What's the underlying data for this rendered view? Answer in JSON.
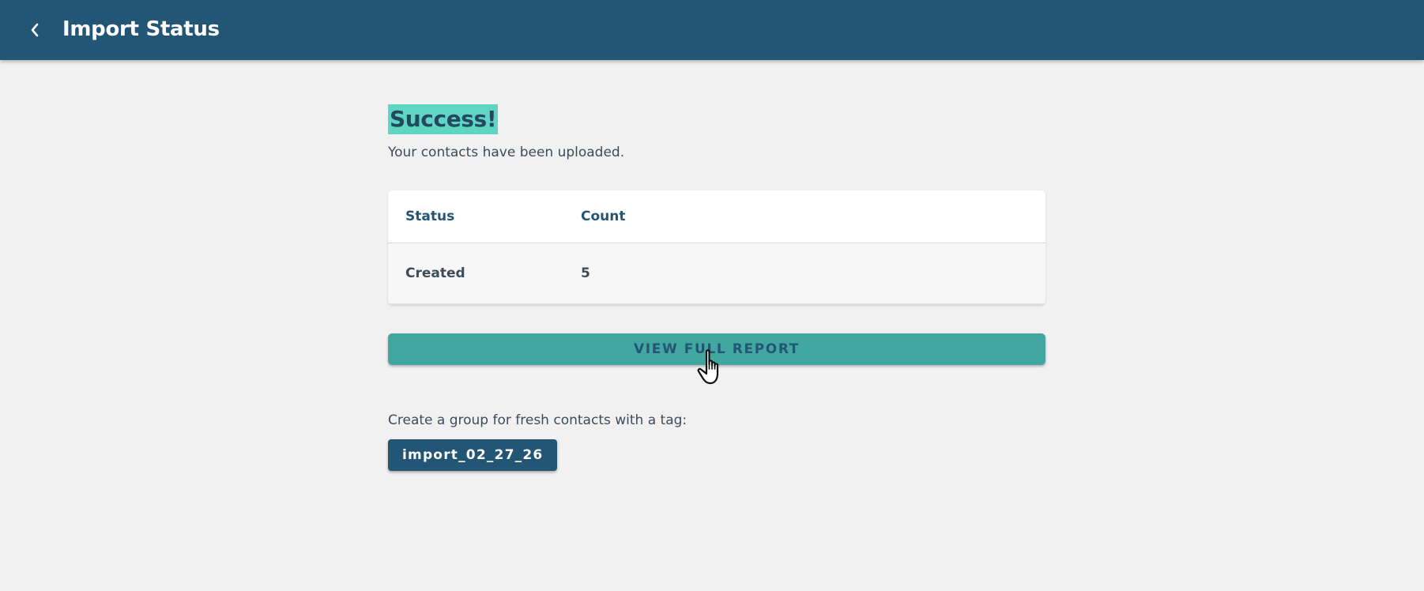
{
  "header": {
    "title": "Import Status",
    "back_icon": "chevron-left-icon",
    "background": "#235574"
  },
  "status": {
    "title": "Success!",
    "title_highlight": "#5fd6c4",
    "message": "Your contacts have been uploaded."
  },
  "table": {
    "headers": [
      "Status",
      "Count"
    ],
    "rows": [
      {
        "status": "Created",
        "count": "5"
      }
    ]
  },
  "report_button": {
    "label": "VIEW FULL REPORT",
    "color": "#43a7a1"
  },
  "group": {
    "label": "Create a group for fresh contacts with a tag:",
    "tag": "import_02_27_26"
  }
}
